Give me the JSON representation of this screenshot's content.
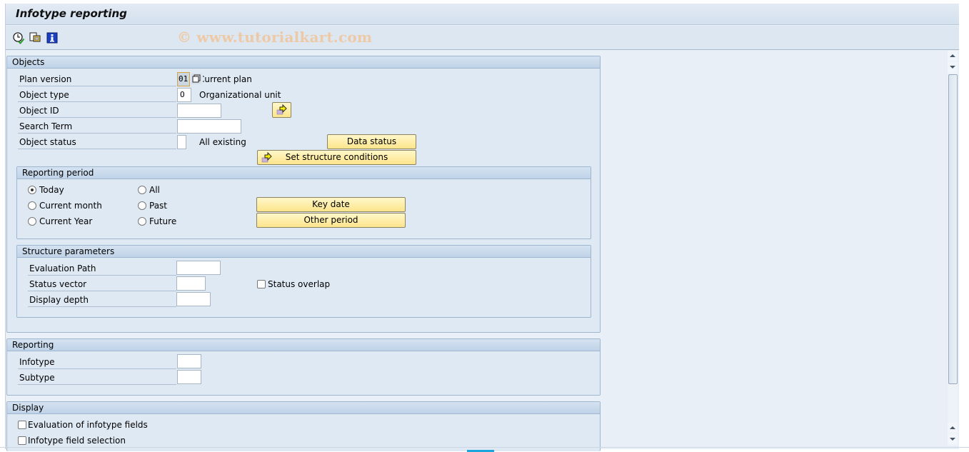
{
  "window": {
    "title": "Infotype reporting",
    "watermark": "© www.tutorialkart.com"
  },
  "toolbar": {
    "icons": [
      {
        "name": "execute-in-background-icon",
        "tooltip": ""
      },
      {
        "name": "selection-options-icon",
        "tooltip": ""
      },
      {
        "name": "info-icon",
        "tooltip": ""
      }
    ]
  },
  "objects": {
    "header": "Objects",
    "plan_version": {
      "label": "Plan version",
      "value": "01",
      "text": "Current plan"
    },
    "object_type": {
      "label": "Object type",
      "value": "O",
      "text": "Organizational unit"
    },
    "object_id": {
      "label": "Object ID",
      "value": ""
    },
    "search_term": {
      "label": "Search Term",
      "value": ""
    },
    "object_status": {
      "label": "Object status",
      "value": "",
      "text": "All existing"
    },
    "data_status_button": "Data status",
    "set_structure_button": "Set structure conditions",
    "reporting_period": {
      "header": "Reporting period",
      "options": [
        {
          "label": "Today",
          "checked": true
        },
        {
          "label": "Current month",
          "checked": false
        },
        {
          "label": "Current Year",
          "checked": false
        },
        {
          "label": "All",
          "checked": false
        },
        {
          "label": "Past",
          "checked": false
        },
        {
          "label": "Future",
          "checked": false
        }
      ],
      "key_date_button": "Key date",
      "other_period_button": "Other period"
    },
    "structure_parameters": {
      "header": "Structure parameters",
      "evaluation_path": {
        "label": "Evaluation Path",
        "value": ""
      },
      "status_vector": {
        "label": "Status vector",
        "value": ""
      },
      "display_depth": {
        "label": "Display depth",
        "value": ""
      },
      "status_overlap": {
        "label": "Status overlap",
        "checked": false
      }
    }
  },
  "reporting": {
    "header": "Reporting",
    "infotype": {
      "label": "Infotype",
      "value": ""
    },
    "subtype": {
      "label": "Subtype",
      "value": ""
    }
  },
  "display": {
    "header": "Display",
    "evaluation_fields": {
      "label": "Evaluation of infotype fields",
      "checked": false
    },
    "field_selection": {
      "label": "Infotype field selection",
      "checked": false
    }
  },
  "colors": {
    "button_bg": "#fce58a",
    "group_bg": "#dfe9f4",
    "header_bg": "#c0d3e8"
  }
}
